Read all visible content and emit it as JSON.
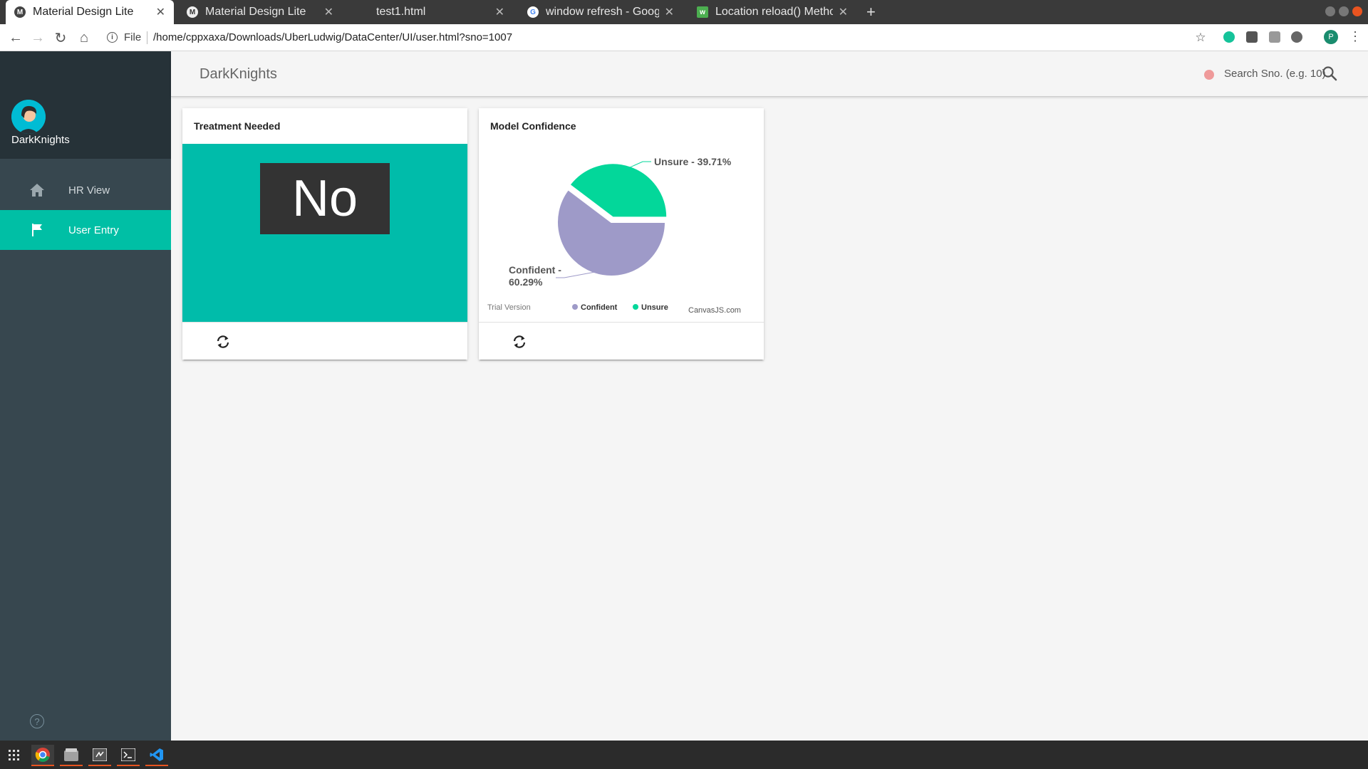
{
  "browser": {
    "tabs": [
      {
        "title": "Material Design Lite",
        "active": true,
        "favicon": "mdl-icon"
      },
      {
        "title": "Material Design Lite",
        "active": false,
        "favicon": "mdl-icon"
      },
      {
        "title": "test1.html",
        "active": false,
        "favicon": "blank-page-icon"
      },
      {
        "title": "window refresh - Google",
        "active": false,
        "favicon": "google-icon"
      },
      {
        "title": "Location reload() Method",
        "active": false,
        "favicon": "w3schools-icon"
      }
    ],
    "new_tab_label": "+",
    "file_label": "File",
    "url": "/home/cppxaxa/Downloads/UberLudwig/DataCenter/UI/user.html?sno=1007",
    "profile_initial": "P"
  },
  "sidebar": {
    "brand": "DarkKnights",
    "items": [
      {
        "label": "HR View",
        "icon": "home-icon",
        "active": false
      },
      {
        "label": "User Entry",
        "icon": "flag-icon",
        "active": true
      }
    ],
    "help_icon": "help-icon"
  },
  "header": {
    "title": "DarkKnights",
    "status_color": "#ef9a9a",
    "search_placeholder": "Search Sno. (e.g. 10)"
  },
  "cards": {
    "treatment": {
      "title": "Treatment Needed",
      "answer": "No",
      "media_color": "#00bcaa"
    },
    "confidence": {
      "title": "Model Confidence",
      "trial_text": "Trial Version",
      "credit_text": "CanvasJS.com"
    }
  },
  "chart_data": {
    "type": "pie",
    "title": "Model Confidence",
    "slices": [
      {
        "label": "Confident",
        "value": 60.29,
        "color": "#9e9ac8",
        "index_label": "Confident - 60.29%"
      },
      {
        "label": "Unsure",
        "value": 39.71,
        "color": "#03d79a",
        "index_label": "Unsure - 39.71%"
      }
    ],
    "legend": [
      "Confident",
      "Unsure"
    ],
    "legend_position": "bottom"
  },
  "colors": {
    "accent": "#00bfa5",
    "sidebar_bg": "#37474f",
    "sidebar_header_bg": "#263238"
  }
}
